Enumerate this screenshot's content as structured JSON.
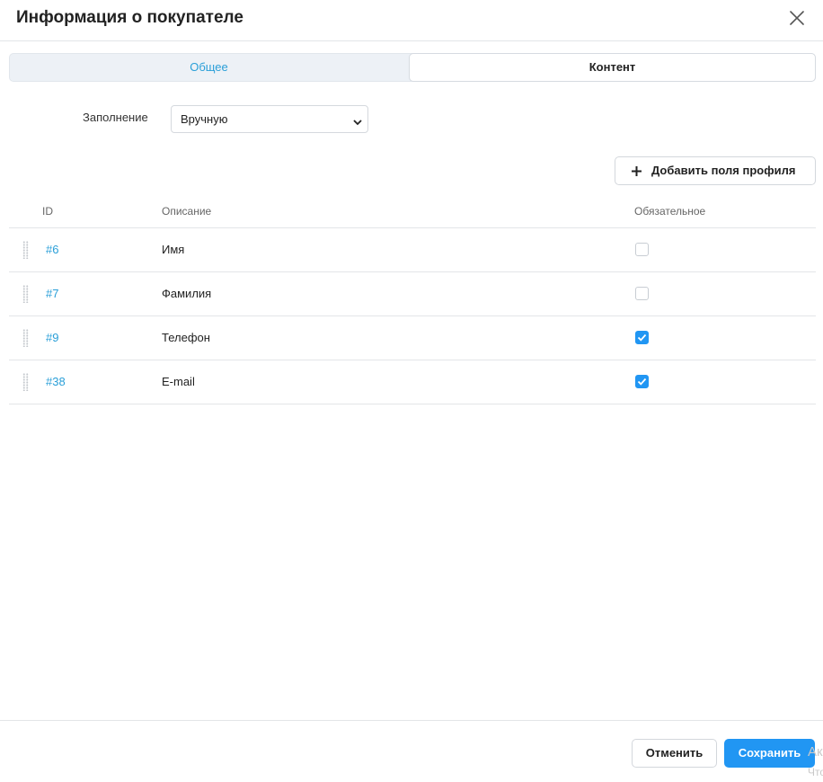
{
  "dialog": {
    "title": "Информация о покупателе"
  },
  "tabs": [
    {
      "label": "Общее",
      "active": false
    },
    {
      "label": "Контент",
      "active": true
    }
  ],
  "fill": {
    "label": "Заполнение",
    "value": "Вручную"
  },
  "add_button": {
    "label": "Добавить поля профиля",
    "icon": "plus-icon"
  },
  "table": {
    "columns": {
      "id": "ID",
      "description": "Описание",
      "required": "Обязательное"
    },
    "rows": [
      {
        "id": "#6",
        "description": "Имя",
        "required": false
      },
      {
        "id": "#7",
        "description": "Фамилия",
        "required": false
      },
      {
        "id": "#9",
        "description": "Телефон",
        "required": true
      },
      {
        "id": "#38",
        "description": "E-mail",
        "required": true
      }
    ]
  },
  "footer": {
    "cancel_label": "Отменить",
    "save_label": "Сохранить"
  },
  "watermark": {
    "line1": "Ак",
    "line2": "Что"
  },
  "colors": {
    "accent": "#2196f3",
    "link": "#2a9fd8"
  }
}
